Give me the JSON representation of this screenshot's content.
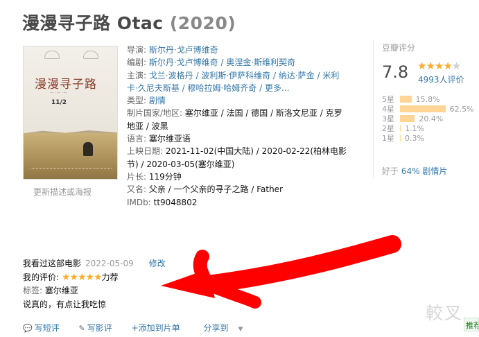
{
  "title": {
    "name": "漫漫寻子路 Otac",
    "year": "(2020)"
  },
  "poster": {
    "title_text": "漫漫寻子路",
    "date_text": "11/2",
    "link_text": "更新描述或海报"
  },
  "info": [
    {
      "label": "导演: ",
      "value": "斯尔丹·戈卢博维奇",
      "type": "link"
    },
    {
      "label": "编剧: ",
      "value": "斯尔丹·戈卢博维奇 / 奥涅金·斯维利契奇",
      "type": "link"
    },
    {
      "label": "主演: ",
      "value": "戈兰·波格丹 / 波利斯·伊萨科维奇 / 纳达·萨金 / 米利",
      "type": "link"
    },
    {
      "label": "",
      "value": "卡·久尼夫斯基 / 穆哈拉姆·哈姆齐奇 / 更多...",
      "type": "link"
    },
    {
      "label": "类型: ",
      "value": "剧情",
      "type": "link"
    },
    {
      "label": "制片国家/地区: ",
      "value": "塞尔维亚 / 法国 / 德国 / 斯洛文尼亚 / 克罗",
      "type": "plain"
    },
    {
      "label": "",
      "value": "地亚 / 波黑",
      "type": "plain"
    },
    {
      "label": "语言: ",
      "value": "塞尔维亚语",
      "type": "plain"
    },
    {
      "label": "上映日期: ",
      "value": "2021-11-02(中国大陆) / 2020-02-22(柏林电影",
      "type": "plain"
    },
    {
      "label": "",
      "value": "节) / 2020-03-05(塞尔维亚)",
      "type": "plain"
    },
    {
      "label": "片长: ",
      "value": "119分钟",
      "type": "plain"
    },
    {
      "label": "又名: ",
      "value": "父亲 / 一个父亲的寻子之路 / Father",
      "type": "plain"
    },
    {
      "label": "IMDb: ",
      "value": "tt9048802",
      "type": "plain"
    }
  ],
  "rating": {
    "heading": "豆瓣评分",
    "score": "7.8",
    "stars_filled": 4,
    "votes": "4993人评价",
    "distribution": [
      {
        "star": "5星",
        "pct": "15.8%",
        "value": 15.8
      },
      {
        "star": "4星",
        "pct": "62.5%",
        "value": 62.5
      },
      {
        "star": "3星",
        "pct": "20.4%",
        "value": 20.4
      },
      {
        "star": "2星",
        "pct": "1.1%",
        "value": 1.1
      },
      {
        "star": "1星",
        "pct": "0.3%",
        "value": 0.3
      }
    ],
    "better_prefix": "好于 ",
    "better_pct": "64% 剧情片"
  },
  "my": {
    "watched": "我看过这部电影",
    "date": "2022-05-09",
    "edit": "修改",
    "rating_label": "我的评价: ",
    "rating_stars": "★★★★★",
    "rating_word": "力荐",
    "tag_label": "标签: ",
    "tag_value": "塞尔维亚",
    "comment": "说真的，有点让我吃惊"
  },
  "actions": {
    "short_review": "写短评",
    "review": "写影评",
    "add_list": "+添加到片单",
    "share": "分享到"
  },
  "watermark": "較叉",
  "recommend": "推荐",
  "colors": {
    "link": "#3377aa",
    "star": "#ffac2d",
    "bar": "#ffd596",
    "arrow": "#ff0000"
  }
}
